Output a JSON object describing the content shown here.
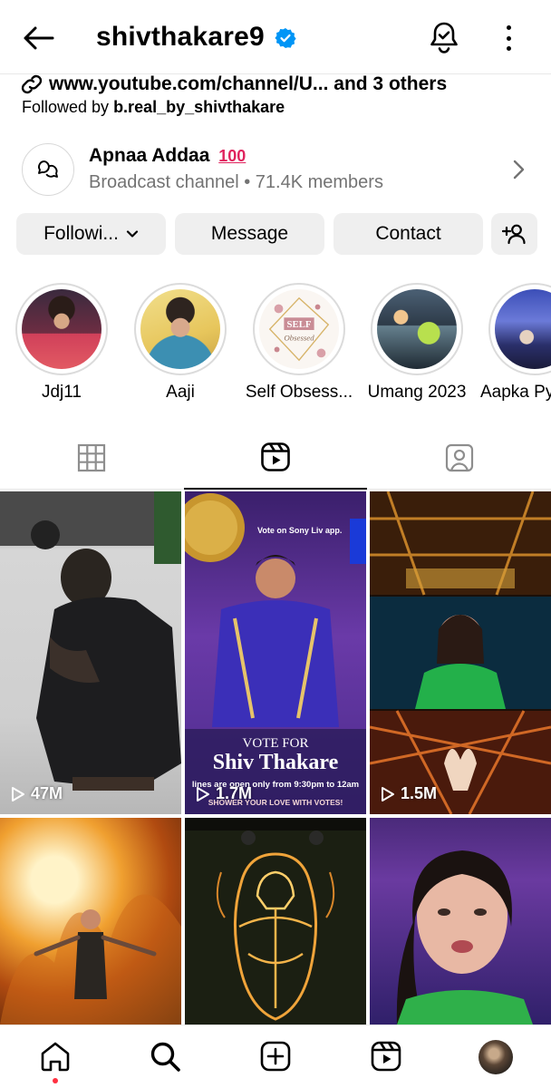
{
  "header": {
    "username": "shivthakare9"
  },
  "bio": {
    "link_text": "www.youtube.com/channel/U... and 3 others",
    "followed_by_prefix": "Followed by ",
    "followed_by_user": "b.real_by_shivthakare"
  },
  "channel": {
    "name": "Apnaa Addaa",
    "emoji": "100",
    "subtitle": "Broadcast channel • 71.4K members"
  },
  "actions": {
    "following_label": "Followi...",
    "message_label": "Message",
    "contact_label": "Contact"
  },
  "highlights": [
    {
      "label": "Jdj11"
    },
    {
      "label": "Aaji"
    },
    {
      "label": "Self Obsess...",
      "cover_text_1": "SELF",
      "cover_text_2": "Obsessed"
    },
    {
      "label": "Umang 2023"
    },
    {
      "label": "Aapka Py"
    }
  ],
  "tabs": [
    "grid",
    "reels",
    "tagged"
  ],
  "grid": [
    {
      "views": "47M"
    },
    {
      "views": "1.7M",
      "poster_vote_note": "Vote on Sony Liv app.",
      "poster_vote_for": "VOTE FOR",
      "poster_name": "Shiv Thakare",
      "poster_lines": "lines are open only from 9:30pm to 12am",
      "poster_footer": "SHOWER YOUR LOVE WITH VOTES!"
    },
    {
      "views": "1.5M"
    },
    {
      "views": ""
    },
    {
      "views": ""
    },
    {
      "views": ""
    }
  ],
  "colors": {
    "verified": "#0095f6",
    "button_bg": "#efefef",
    "muted_text": "#737373",
    "notification_dot": "#ff3040"
  }
}
